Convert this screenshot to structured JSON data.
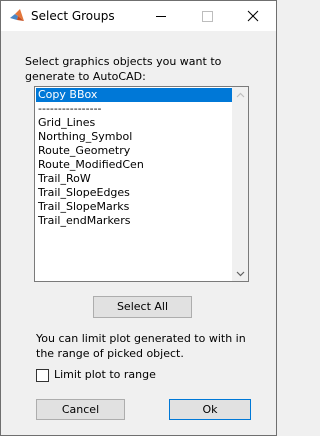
{
  "window": {
    "title": "Select Groups",
    "icons": {
      "app": "matlab-icon",
      "minimize": "minimize-icon",
      "maximize": "maximize-icon",
      "close": "close-icon"
    }
  },
  "prompt": "Select graphics objects you want to generate to AutoCAD:",
  "list": {
    "items": [
      "Copy BBox",
      "----------------",
      "Grid_Lines",
      "Northing_Symbol",
      "Route_Geometry",
      "Route_ModifiedCen",
      "Trail_RoW",
      "Trail_SlopeEdges",
      "Trail_SlopeMarks",
      "Trail_endMarkers"
    ],
    "selected_index": 0
  },
  "buttons": {
    "select_all": "Select All",
    "cancel": "Cancel",
    "ok": "Ok"
  },
  "info": "You can limit plot generated to with in the range of picked object.",
  "checkbox": {
    "label": "Limit plot to range",
    "checked": false
  },
  "colors": {
    "selection": "#0078d7",
    "background": "#f0f0f0"
  }
}
